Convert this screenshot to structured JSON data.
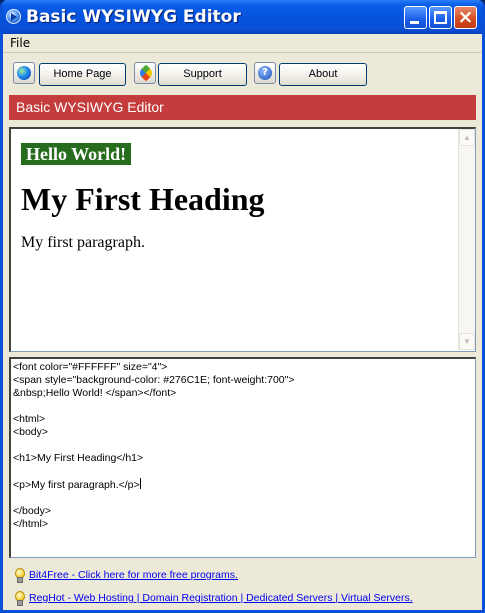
{
  "window": {
    "title": "Basic WYSIWYG Editor",
    "icon": "app-arrow-icon",
    "controls": {
      "minimize": "minimize-icon",
      "maximize": "maximize-icon",
      "close": "×"
    }
  },
  "menu": {
    "file": "File"
  },
  "toolbar": {
    "home_label": "Home Page",
    "support_label": "Support",
    "about_label": "About",
    "icons": [
      "globe-icon",
      "heart-icon",
      "help-icon"
    ]
  },
  "header": {
    "title": "Basic WYSIWYG Editor",
    "color": "#c43c3c"
  },
  "preview": {
    "hello": "Hello World!",
    "hello_bg": "#276C1E",
    "hello_color": "#FFFFFF",
    "heading": "My First Heading",
    "paragraph": "My first paragraph.",
    "scroll_up": "▲",
    "scroll_down": "▼"
  },
  "source": {
    "lines": [
      "<font color=\"#FFFFFF\" size=\"4\">",
      "<span style=\"background-color: #276C1E; font-weight:700\">",
      "&nbsp;Hello World! </span></font>",
      "",
      "<html>",
      "<body>",
      "",
      "<h1>My First Heading</h1>",
      "",
      "<p>My first paragraph.</p>",
      "",
      "</body>",
      "</html>"
    ]
  },
  "footer": {
    "link1": "Bit4Free - Click here for more free programs.",
    "link2": "RegHot - Web Hosting | Domain Registration | Dedicated Servers | Virtual Servers."
  }
}
